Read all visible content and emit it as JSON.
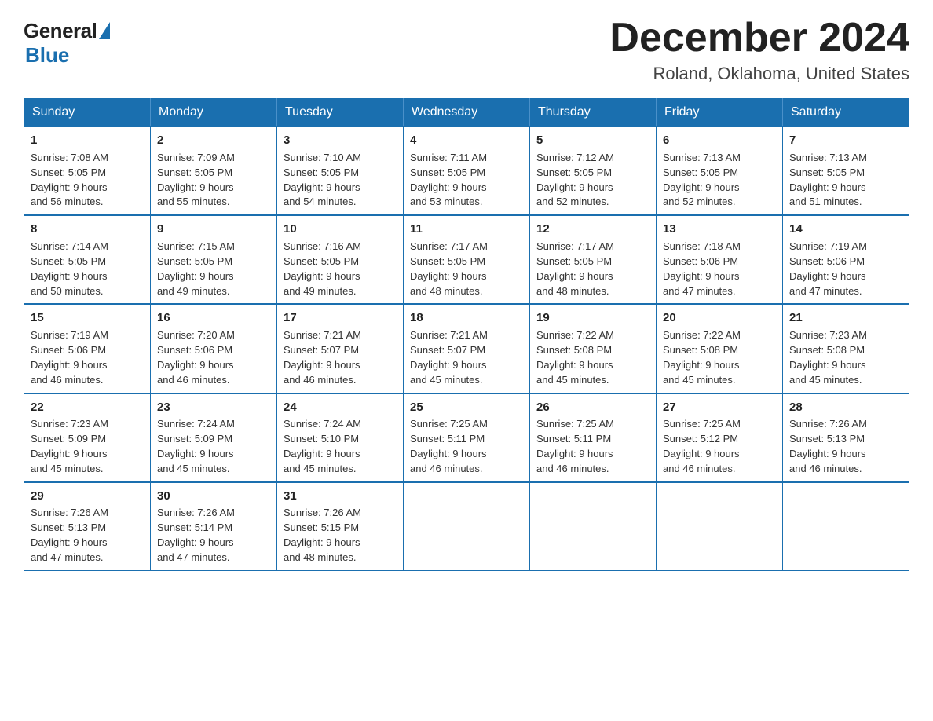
{
  "header": {
    "logo_general": "General",
    "logo_blue": "Blue",
    "month_year": "December 2024",
    "location": "Roland, Oklahoma, United States"
  },
  "weekdays": [
    "Sunday",
    "Monday",
    "Tuesday",
    "Wednesday",
    "Thursday",
    "Friday",
    "Saturday"
  ],
  "weeks": [
    [
      {
        "day": "1",
        "sunrise": "7:08 AM",
        "sunset": "5:05 PM",
        "daylight": "9 hours and 56 minutes."
      },
      {
        "day": "2",
        "sunrise": "7:09 AM",
        "sunset": "5:05 PM",
        "daylight": "9 hours and 55 minutes."
      },
      {
        "day": "3",
        "sunrise": "7:10 AM",
        "sunset": "5:05 PM",
        "daylight": "9 hours and 54 minutes."
      },
      {
        "day": "4",
        "sunrise": "7:11 AM",
        "sunset": "5:05 PM",
        "daylight": "9 hours and 53 minutes."
      },
      {
        "day": "5",
        "sunrise": "7:12 AM",
        "sunset": "5:05 PM",
        "daylight": "9 hours and 52 minutes."
      },
      {
        "day": "6",
        "sunrise": "7:13 AM",
        "sunset": "5:05 PM",
        "daylight": "9 hours and 52 minutes."
      },
      {
        "day": "7",
        "sunrise": "7:13 AM",
        "sunset": "5:05 PM",
        "daylight": "9 hours and 51 minutes."
      }
    ],
    [
      {
        "day": "8",
        "sunrise": "7:14 AM",
        "sunset": "5:05 PM",
        "daylight": "9 hours and 50 minutes."
      },
      {
        "day": "9",
        "sunrise": "7:15 AM",
        "sunset": "5:05 PM",
        "daylight": "9 hours and 49 minutes."
      },
      {
        "day": "10",
        "sunrise": "7:16 AM",
        "sunset": "5:05 PM",
        "daylight": "9 hours and 49 minutes."
      },
      {
        "day": "11",
        "sunrise": "7:17 AM",
        "sunset": "5:05 PM",
        "daylight": "9 hours and 48 minutes."
      },
      {
        "day": "12",
        "sunrise": "7:17 AM",
        "sunset": "5:05 PM",
        "daylight": "9 hours and 48 minutes."
      },
      {
        "day": "13",
        "sunrise": "7:18 AM",
        "sunset": "5:06 PM",
        "daylight": "9 hours and 47 minutes."
      },
      {
        "day": "14",
        "sunrise": "7:19 AM",
        "sunset": "5:06 PM",
        "daylight": "9 hours and 47 minutes."
      }
    ],
    [
      {
        "day": "15",
        "sunrise": "7:19 AM",
        "sunset": "5:06 PM",
        "daylight": "9 hours and 46 minutes."
      },
      {
        "day": "16",
        "sunrise": "7:20 AM",
        "sunset": "5:06 PM",
        "daylight": "9 hours and 46 minutes."
      },
      {
        "day": "17",
        "sunrise": "7:21 AM",
        "sunset": "5:07 PM",
        "daylight": "9 hours and 46 minutes."
      },
      {
        "day": "18",
        "sunrise": "7:21 AM",
        "sunset": "5:07 PM",
        "daylight": "9 hours and 45 minutes."
      },
      {
        "day": "19",
        "sunrise": "7:22 AM",
        "sunset": "5:08 PM",
        "daylight": "9 hours and 45 minutes."
      },
      {
        "day": "20",
        "sunrise": "7:22 AM",
        "sunset": "5:08 PM",
        "daylight": "9 hours and 45 minutes."
      },
      {
        "day": "21",
        "sunrise": "7:23 AM",
        "sunset": "5:08 PM",
        "daylight": "9 hours and 45 minutes."
      }
    ],
    [
      {
        "day": "22",
        "sunrise": "7:23 AM",
        "sunset": "5:09 PM",
        "daylight": "9 hours and 45 minutes."
      },
      {
        "day": "23",
        "sunrise": "7:24 AM",
        "sunset": "5:09 PM",
        "daylight": "9 hours and 45 minutes."
      },
      {
        "day": "24",
        "sunrise": "7:24 AM",
        "sunset": "5:10 PM",
        "daylight": "9 hours and 45 minutes."
      },
      {
        "day": "25",
        "sunrise": "7:25 AM",
        "sunset": "5:11 PM",
        "daylight": "9 hours and 46 minutes."
      },
      {
        "day": "26",
        "sunrise": "7:25 AM",
        "sunset": "5:11 PM",
        "daylight": "9 hours and 46 minutes."
      },
      {
        "day": "27",
        "sunrise": "7:25 AM",
        "sunset": "5:12 PM",
        "daylight": "9 hours and 46 minutes."
      },
      {
        "day": "28",
        "sunrise": "7:26 AM",
        "sunset": "5:13 PM",
        "daylight": "9 hours and 46 minutes."
      }
    ],
    [
      {
        "day": "29",
        "sunrise": "7:26 AM",
        "sunset": "5:13 PM",
        "daylight": "9 hours and 47 minutes."
      },
      {
        "day": "30",
        "sunrise": "7:26 AM",
        "sunset": "5:14 PM",
        "daylight": "9 hours and 47 minutes."
      },
      {
        "day": "31",
        "sunrise": "7:26 AM",
        "sunset": "5:15 PM",
        "daylight": "9 hours and 48 minutes."
      },
      null,
      null,
      null,
      null
    ]
  ]
}
